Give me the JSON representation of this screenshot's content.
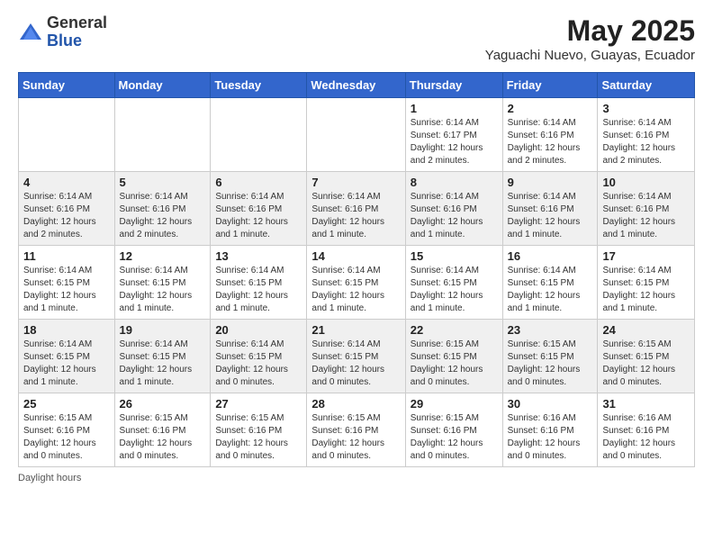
{
  "logo": {
    "general": "General",
    "blue": "Blue"
  },
  "title": "May 2025",
  "location": "Yaguachi Nuevo, Guayas, Ecuador",
  "days_of_week": [
    "Sunday",
    "Monday",
    "Tuesday",
    "Wednesday",
    "Thursday",
    "Friday",
    "Saturday"
  ],
  "footer": "Daylight hours",
  "weeks": [
    [
      {
        "num": "",
        "info": ""
      },
      {
        "num": "",
        "info": ""
      },
      {
        "num": "",
        "info": ""
      },
      {
        "num": "",
        "info": ""
      },
      {
        "num": "1",
        "info": "Sunrise: 6:14 AM\nSunset: 6:17 PM\nDaylight: 12 hours and 2 minutes."
      },
      {
        "num": "2",
        "info": "Sunrise: 6:14 AM\nSunset: 6:16 PM\nDaylight: 12 hours and 2 minutes."
      },
      {
        "num": "3",
        "info": "Sunrise: 6:14 AM\nSunset: 6:16 PM\nDaylight: 12 hours and 2 minutes."
      }
    ],
    [
      {
        "num": "4",
        "info": "Sunrise: 6:14 AM\nSunset: 6:16 PM\nDaylight: 12 hours and 2 minutes."
      },
      {
        "num": "5",
        "info": "Sunrise: 6:14 AM\nSunset: 6:16 PM\nDaylight: 12 hours and 2 minutes."
      },
      {
        "num": "6",
        "info": "Sunrise: 6:14 AM\nSunset: 6:16 PM\nDaylight: 12 hours and 1 minute."
      },
      {
        "num": "7",
        "info": "Sunrise: 6:14 AM\nSunset: 6:16 PM\nDaylight: 12 hours and 1 minute."
      },
      {
        "num": "8",
        "info": "Sunrise: 6:14 AM\nSunset: 6:16 PM\nDaylight: 12 hours and 1 minute."
      },
      {
        "num": "9",
        "info": "Sunrise: 6:14 AM\nSunset: 6:16 PM\nDaylight: 12 hours and 1 minute."
      },
      {
        "num": "10",
        "info": "Sunrise: 6:14 AM\nSunset: 6:16 PM\nDaylight: 12 hours and 1 minute."
      }
    ],
    [
      {
        "num": "11",
        "info": "Sunrise: 6:14 AM\nSunset: 6:15 PM\nDaylight: 12 hours and 1 minute."
      },
      {
        "num": "12",
        "info": "Sunrise: 6:14 AM\nSunset: 6:15 PM\nDaylight: 12 hours and 1 minute."
      },
      {
        "num": "13",
        "info": "Sunrise: 6:14 AM\nSunset: 6:15 PM\nDaylight: 12 hours and 1 minute."
      },
      {
        "num": "14",
        "info": "Sunrise: 6:14 AM\nSunset: 6:15 PM\nDaylight: 12 hours and 1 minute."
      },
      {
        "num": "15",
        "info": "Sunrise: 6:14 AM\nSunset: 6:15 PM\nDaylight: 12 hours and 1 minute."
      },
      {
        "num": "16",
        "info": "Sunrise: 6:14 AM\nSunset: 6:15 PM\nDaylight: 12 hours and 1 minute."
      },
      {
        "num": "17",
        "info": "Sunrise: 6:14 AM\nSunset: 6:15 PM\nDaylight: 12 hours and 1 minute."
      }
    ],
    [
      {
        "num": "18",
        "info": "Sunrise: 6:14 AM\nSunset: 6:15 PM\nDaylight: 12 hours and 1 minute."
      },
      {
        "num": "19",
        "info": "Sunrise: 6:14 AM\nSunset: 6:15 PM\nDaylight: 12 hours and 1 minute."
      },
      {
        "num": "20",
        "info": "Sunrise: 6:14 AM\nSunset: 6:15 PM\nDaylight: 12 hours and 0 minutes."
      },
      {
        "num": "21",
        "info": "Sunrise: 6:14 AM\nSunset: 6:15 PM\nDaylight: 12 hours and 0 minutes."
      },
      {
        "num": "22",
        "info": "Sunrise: 6:15 AM\nSunset: 6:15 PM\nDaylight: 12 hours and 0 minutes."
      },
      {
        "num": "23",
        "info": "Sunrise: 6:15 AM\nSunset: 6:15 PM\nDaylight: 12 hours and 0 minutes."
      },
      {
        "num": "24",
        "info": "Sunrise: 6:15 AM\nSunset: 6:15 PM\nDaylight: 12 hours and 0 minutes."
      }
    ],
    [
      {
        "num": "25",
        "info": "Sunrise: 6:15 AM\nSunset: 6:16 PM\nDaylight: 12 hours and 0 minutes."
      },
      {
        "num": "26",
        "info": "Sunrise: 6:15 AM\nSunset: 6:16 PM\nDaylight: 12 hours and 0 minutes."
      },
      {
        "num": "27",
        "info": "Sunrise: 6:15 AM\nSunset: 6:16 PM\nDaylight: 12 hours and 0 minutes."
      },
      {
        "num": "28",
        "info": "Sunrise: 6:15 AM\nSunset: 6:16 PM\nDaylight: 12 hours and 0 minutes."
      },
      {
        "num": "29",
        "info": "Sunrise: 6:15 AM\nSunset: 6:16 PM\nDaylight: 12 hours and 0 minutes."
      },
      {
        "num": "30",
        "info": "Sunrise: 6:16 AM\nSunset: 6:16 PM\nDaylight: 12 hours and 0 minutes."
      },
      {
        "num": "31",
        "info": "Sunrise: 6:16 AM\nSunset: 6:16 PM\nDaylight: 12 hours and 0 minutes."
      }
    ]
  ]
}
